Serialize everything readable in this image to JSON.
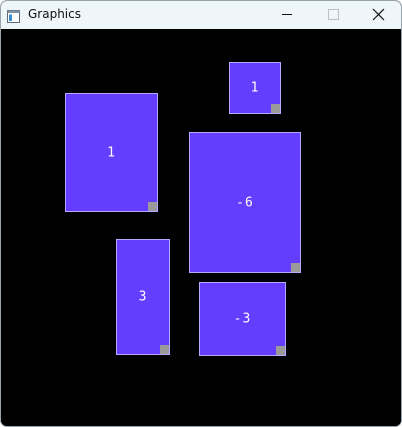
{
  "window": {
    "title": "Graphics"
  },
  "titlebar": {
    "icon": "app-window-icon",
    "buttons": [
      "minimize-icon",
      "maximize-icon",
      "close-icon"
    ]
  },
  "colors": {
    "tile_fill": "#653dff",
    "tile_border": "#b7a8ff",
    "handle": "#9a9a9a",
    "background": "#000000"
  },
  "tiles": [
    {
      "label": "1"
    },
    {
      "label": "1"
    },
    {
      "label": "-6"
    },
    {
      "label": "3"
    },
    {
      "label": "-3"
    }
  ]
}
